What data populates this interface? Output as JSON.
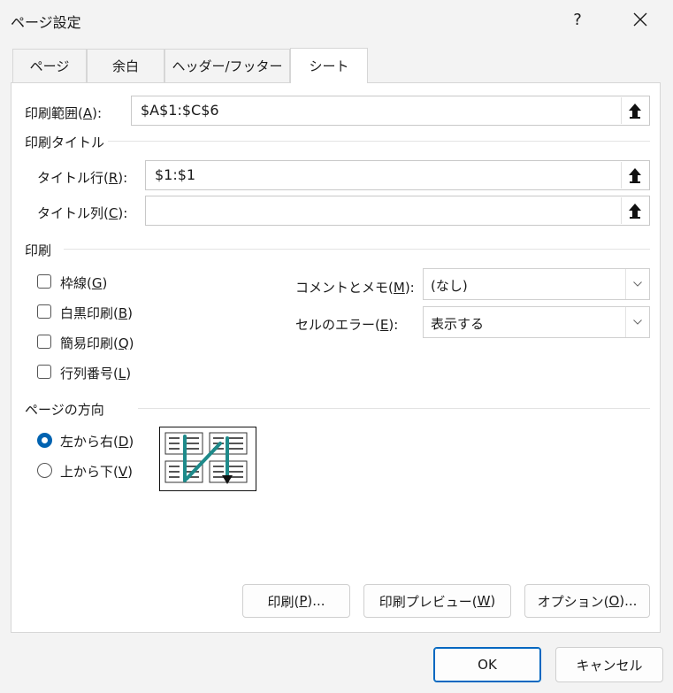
{
  "window": {
    "title": "ページ設定",
    "help": "?"
  },
  "tabs": [
    {
      "label": "ページ"
    },
    {
      "label": "余白"
    },
    {
      "label": "ヘッダー/フッター"
    },
    {
      "label": "シート"
    }
  ],
  "print_area": {
    "label_pre": "印刷範囲(",
    "key": "A",
    "label_post": "):",
    "value": "$A$1:$C$6"
  },
  "print_titles": {
    "group": "印刷タイトル",
    "rows": {
      "label_pre": "タイトル行(",
      "key": "R",
      "label_post": "):",
      "value": "$1:$1"
    },
    "cols": {
      "label_pre": "タイトル列(",
      "key": "C",
      "label_post": "):",
      "value": ""
    }
  },
  "print": {
    "group": "印刷",
    "checkboxes": [
      {
        "pre": "枠線(",
        "key": "G",
        "post": ")",
        "checked": false
      },
      {
        "pre": "白黒印刷(",
        "key": "B",
        "post": ")",
        "checked": false
      },
      {
        "pre": "簡易印刷(",
        "key": "Q",
        "post": ")",
        "checked": false
      },
      {
        "pre": "行列番号(",
        "key": "L",
        "post": ")",
        "checked": false
      }
    ],
    "comments": {
      "pre": "コメントとメモ(",
      "key": "M",
      "post": "):",
      "value": "(なし)"
    },
    "errors": {
      "pre": "セルのエラー(",
      "key": "E",
      "post": "):",
      "value": "表示する"
    }
  },
  "page_order": {
    "group": "ページの方向",
    "options": [
      {
        "pre": "左から右(",
        "key": "D",
        "post": ")",
        "selected": true
      },
      {
        "pre": "上から下(",
        "key": "V",
        "post": ")",
        "selected": false
      }
    ]
  },
  "buttons": {
    "print": {
      "pre": "印刷(",
      "key": "P",
      "post": ")..."
    },
    "preview": {
      "pre": "印刷プレビュー(",
      "key": "W",
      "post": ")"
    },
    "options": {
      "pre": "オプション(",
      "key": "O",
      "post": ")..."
    },
    "ok": "OK",
    "cancel": "キャンセル"
  },
  "colors": {
    "accent": "#0063b1",
    "arrow": "#1e8a8a"
  }
}
